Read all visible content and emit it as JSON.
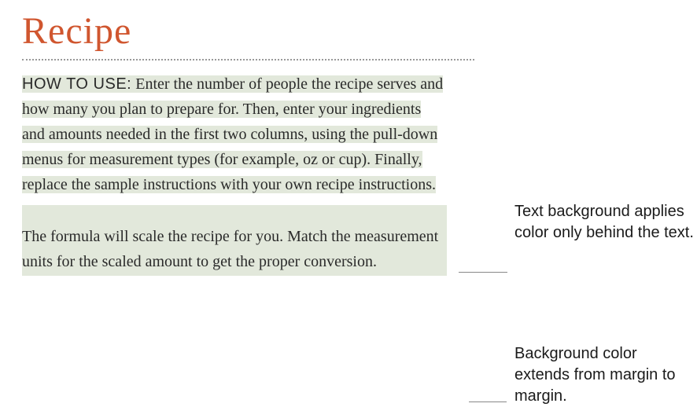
{
  "title": "Recipe",
  "paragraph1": {
    "label": "HOW TO USE:",
    "text": " Enter the number of people the recipe serves and how many you plan to prepare for. Then, enter your ingredients and amounts needed in the first two columns, using the pull-down menus for measurement types (for example, oz or cup). Finally, replace the sample instructions with your own recipe instructions."
  },
  "paragraph2": "The formula will scale the recipe for you. Match the measurement units for the scaled amount to get the proper conversion.",
  "annotations": {
    "a1": "Text background applies color only behind the text.",
    "a2": "Background color extends from margin to margin."
  },
  "colors": {
    "title": "#d0562f",
    "highlight": "#e2e8db"
  }
}
